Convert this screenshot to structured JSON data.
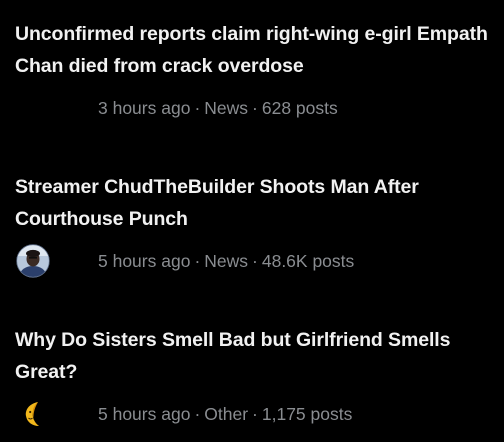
{
  "colors": {
    "background": "#000000",
    "title": "#f1f1f1",
    "meta": "#8a8d91"
  },
  "threads": [
    {
      "title": "Unconfirmed reports claim right-wing e-girl Empath Chan died from crack overdose",
      "time": "3 hours ago",
      "category": "News",
      "posts": "628 posts",
      "avatar": "none"
    },
    {
      "title": "Streamer ChudTheBuilder Shoots Man After Courthouse Punch",
      "time": "5 hours ago",
      "category": "News",
      "posts": "48.6K posts",
      "avatar": "person-avatar"
    },
    {
      "title": "Why Do Sisters Smell Bad but Girlfriend Smells Great?",
      "time": "5 hours ago",
      "category": "Other",
      "posts": "1,175 posts",
      "avatar": "crescent-moon-icon"
    }
  ],
  "separator": "·"
}
